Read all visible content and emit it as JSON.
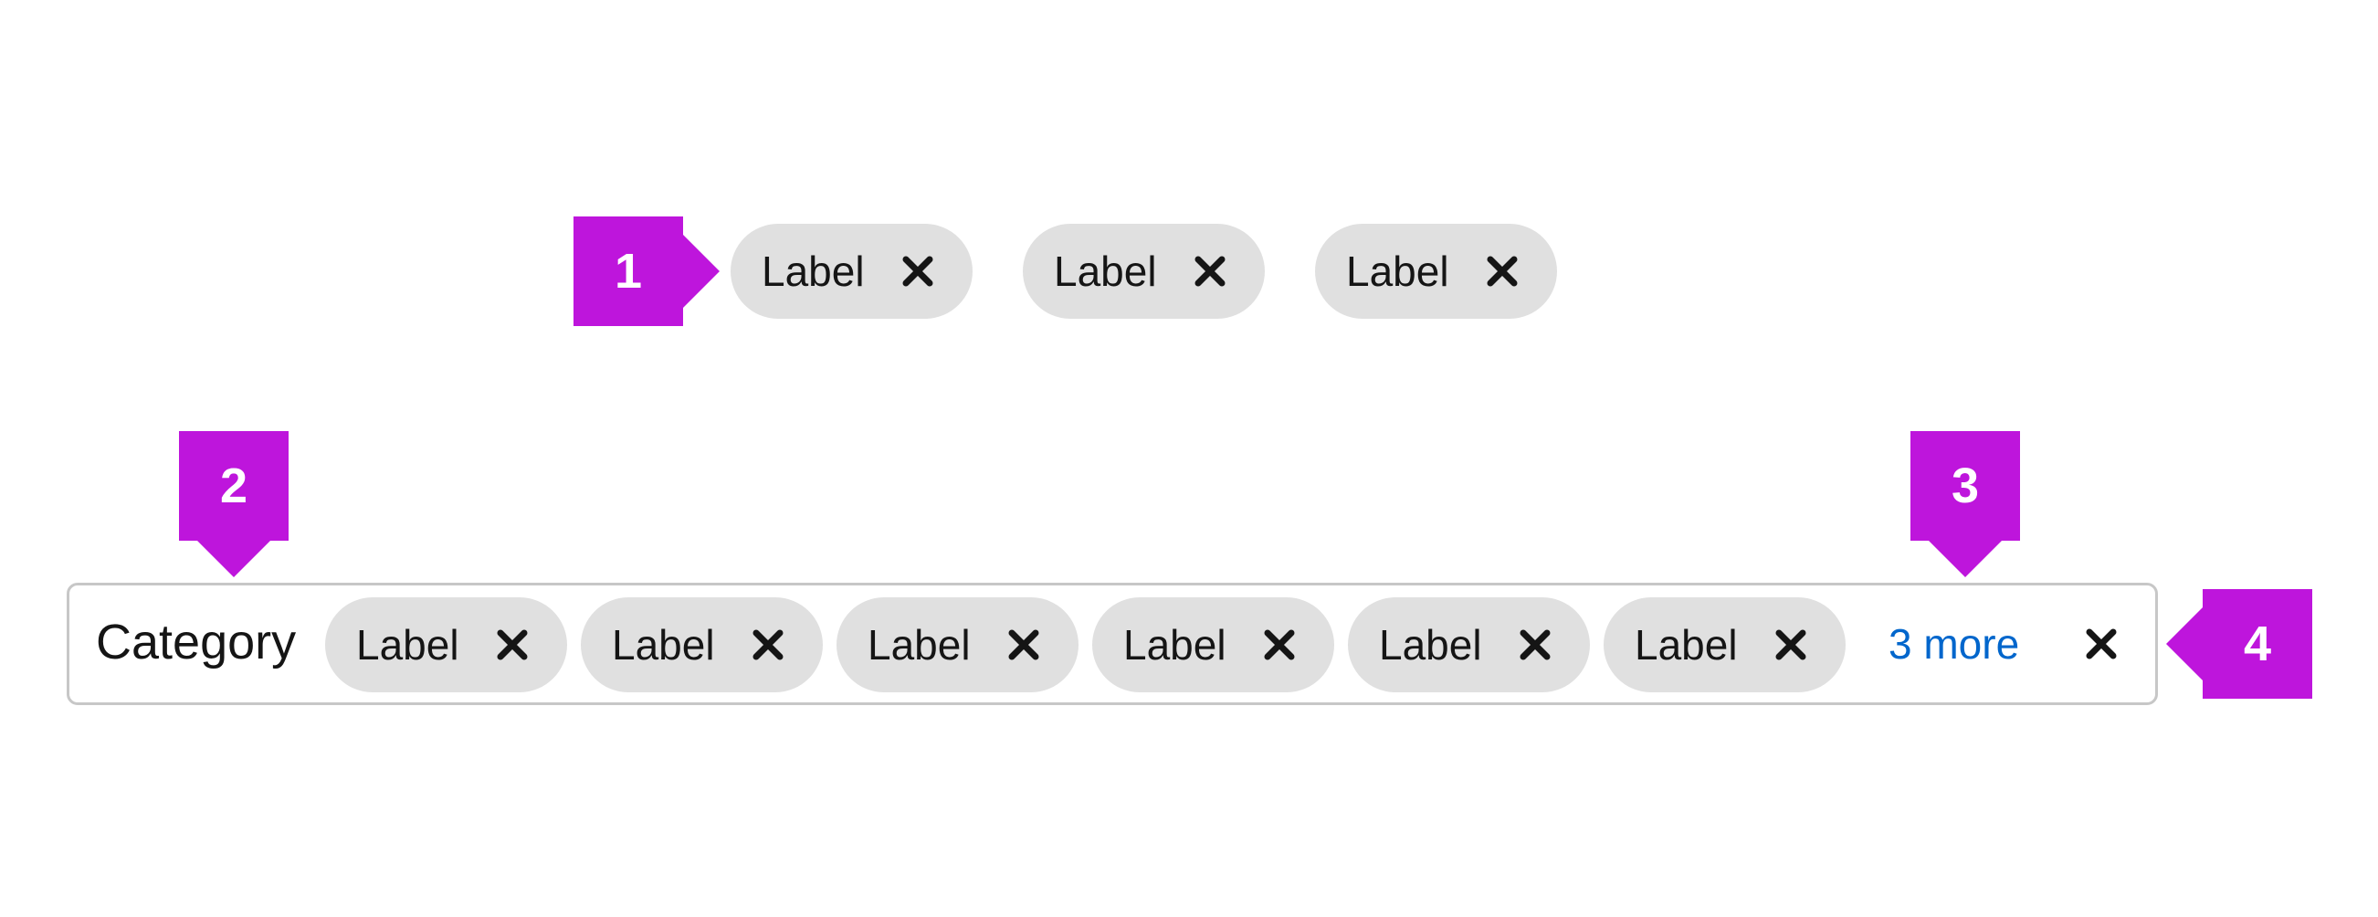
{
  "standalone_chips": {
    "labels": [
      "Label",
      "Label",
      "Label"
    ],
    "close_icon": "close-icon"
  },
  "chip_group": {
    "category": "Category",
    "labels": [
      "Label",
      "Label",
      "Label",
      "Label",
      "Label",
      "Label"
    ],
    "more_label": "3 more",
    "close_icon": "close-icon"
  },
  "callouts": [
    "1",
    "2",
    "3",
    "4"
  ],
  "colors": {
    "callout": "#be15dc",
    "chip_background": "#e0e0e0",
    "link": "#0066cc",
    "group_border": "#c7c7c7",
    "text": "#151515"
  }
}
